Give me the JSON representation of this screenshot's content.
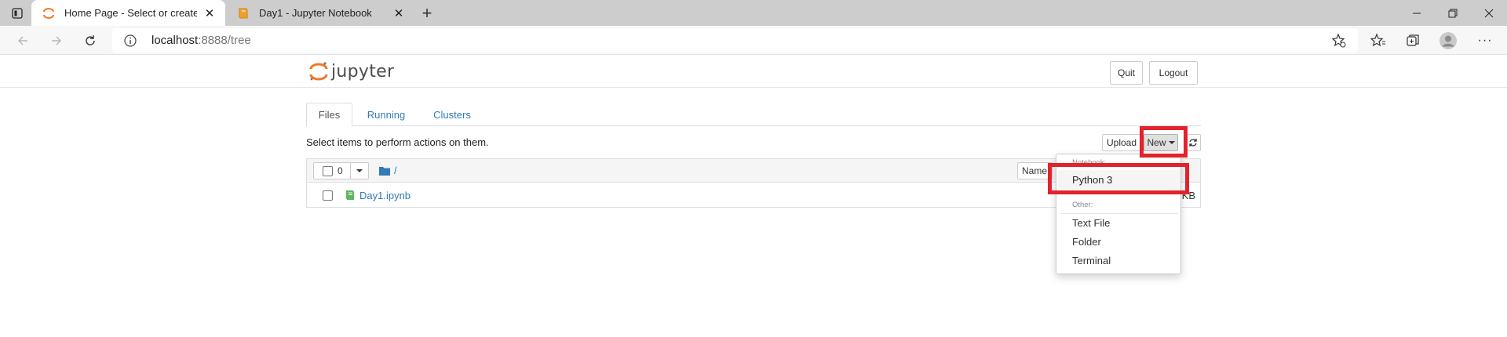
{
  "browser": {
    "tabs": [
      {
        "title": "Home Page - Select or create a n",
        "active": true,
        "icon": "jupyter-favicon"
      },
      {
        "title": "Day1 - Jupyter Notebook",
        "active": false,
        "icon": "notebook-favicon"
      }
    ],
    "address": {
      "host": "localhost",
      "rest": ":8888/tree"
    }
  },
  "header": {
    "logo_text": "jupyter",
    "quit_label": "Quit",
    "logout_label": "Logout"
  },
  "nav_tabs": [
    {
      "label": "Files",
      "active": true
    },
    {
      "label": "Running",
      "active": false
    },
    {
      "label": "Clusters",
      "active": false
    }
  ],
  "toolbar": {
    "hint": "Select items to perform actions on them.",
    "upload_label": "Upload",
    "new_label": "New"
  },
  "list_header": {
    "selected_count": "0",
    "breadcrumb": "/",
    "sort_label": "Name"
  },
  "files": [
    {
      "name": "Day1.ipynb",
      "size": "KB",
      "icon": "notebook-icon"
    }
  ],
  "new_menu": {
    "notebook_header": "Notebook:",
    "python3_label": "Python 3",
    "other_header": "Other:",
    "text_file_label": "Text File",
    "folder_label": "Folder",
    "terminal_label": "Terminal"
  },
  "colors": {
    "jupyter_orange": "#f37626",
    "link_blue": "#337ab7",
    "highlight_red": "#e3222c",
    "notebook_green": "#5cb85c"
  }
}
